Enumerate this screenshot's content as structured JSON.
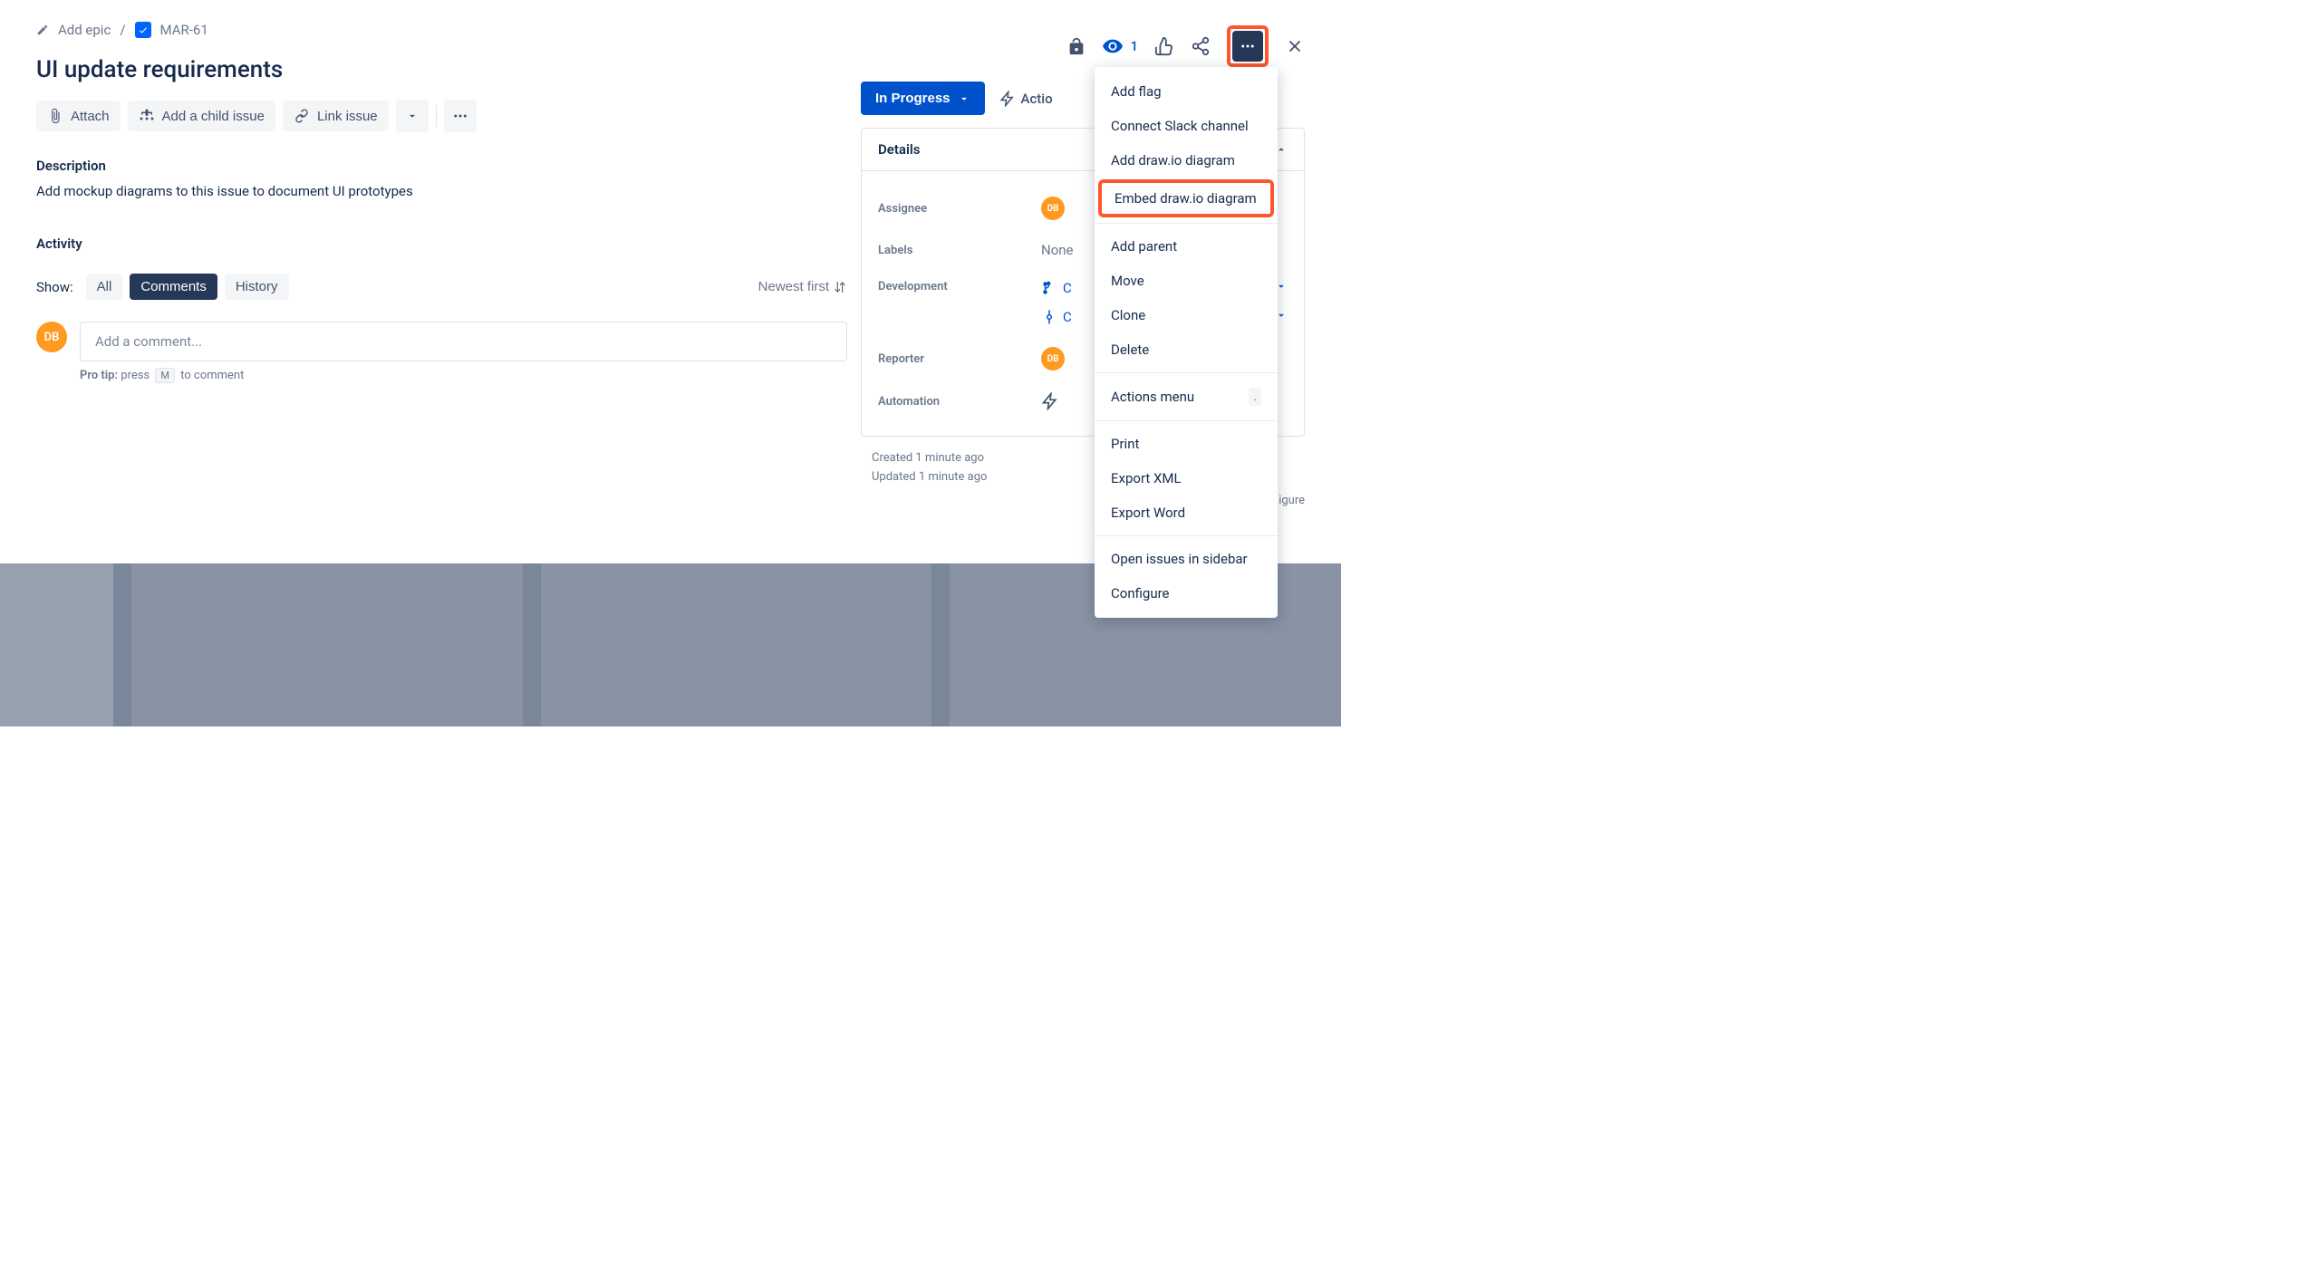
{
  "breadcrumb": {
    "add_epic": "Add epic",
    "issue_key": "MAR-61"
  },
  "header": {
    "watch_count": "1"
  },
  "issue": {
    "title": "UI update requirements"
  },
  "toolbar": {
    "attach": "Attach",
    "add_child": "Add a child issue",
    "link_issue": "Link issue"
  },
  "description": {
    "label": "Description",
    "text": "Add mockup diagrams to this issue to document UI prototypes"
  },
  "activity": {
    "label": "Activity",
    "show": "Show:",
    "filters": {
      "all": "All",
      "comments": "Comments",
      "history": "History"
    },
    "sort": "Newest first",
    "comment_placeholder": "Add a comment...",
    "pro_tip_label": "Pro tip:",
    "pro_tip_press": "press",
    "pro_tip_key": "M",
    "pro_tip_end": "to comment",
    "avatar_initials": "DB"
  },
  "status": {
    "label": "In Progress",
    "actions_trigger": "Actio"
  },
  "details": {
    "header": "Details",
    "assignee_label": "Assignee",
    "assignee_initials": "DB",
    "labels_label": "Labels",
    "labels_value": "None",
    "development_label": "Development",
    "dev_create": "C",
    "dev_create2": "C",
    "reporter_label": "Reporter",
    "reporter_initials": "DB",
    "automation_label": "Automation"
  },
  "timestamps": {
    "created": "Created 1 minute ago",
    "updated": "Updated 1 minute ago"
  },
  "configure": "igure",
  "menu": {
    "add_flag": "Add flag",
    "connect_slack": "Connect Slack channel",
    "add_drawio": "Add draw.io diagram",
    "embed_drawio": "Embed draw.io diagram",
    "add_parent": "Add parent",
    "move": "Move",
    "clone": "Clone",
    "delete": "Delete",
    "actions_menu": "Actions menu",
    "print": "Print",
    "export_xml": "Export XML",
    "export_word": "Export Word",
    "open_sidebar": "Open issues in sidebar",
    "configure": "Configure"
  }
}
